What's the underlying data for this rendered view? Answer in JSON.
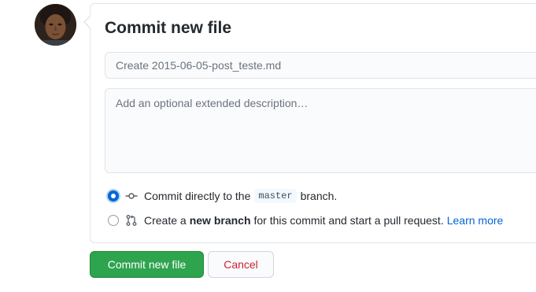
{
  "form": {
    "title": "Commit new file",
    "summary_placeholder": "Create 2015-06-05-post_teste.md",
    "description_placeholder": "Add an optional extended description…"
  },
  "options": {
    "direct": {
      "text_before": "Commit directly to the",
      "branch": "master",
      "text_after": "branch.",
      "checked": true,
      "icon": "git-commit-icon"
    },
    "new_branch": {
      "text_before": "Create a",
      "emphasis": "new branch",
      "text_after": "for this commit and start a pull request.",
      "link": "Learn more",
      "checked": false,
      "icon": "git-pull-request-icon"
    }
  },
  "buttons": {
    "commit": "Commit new file",
    "cancel": "Cancel"
  },
  "colors": {
    "primary": "#2ea44f",
    "radio_accent": "#0366d6",
    "cancel_text": "#cb2431",
    "link": "#0366d6"
  }
}
